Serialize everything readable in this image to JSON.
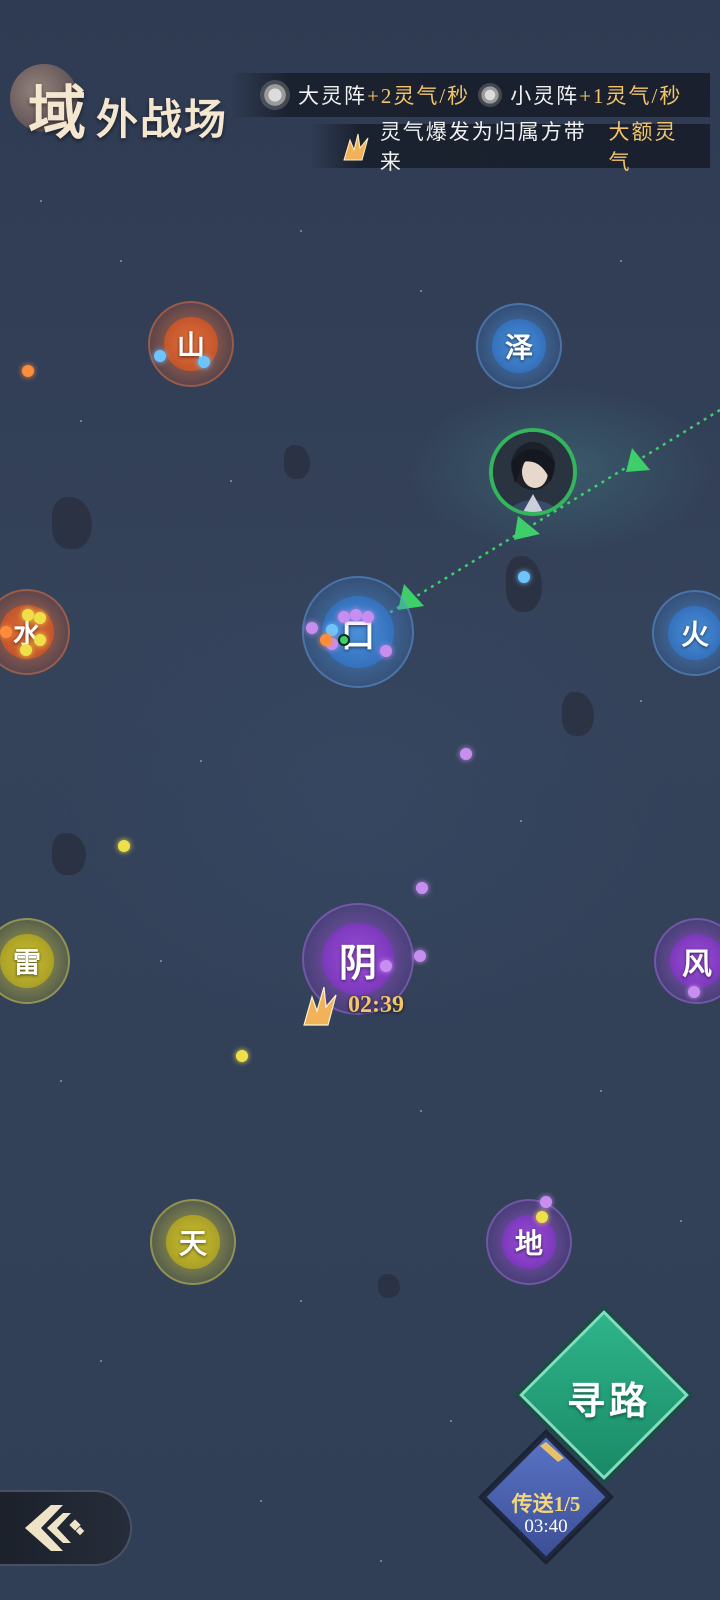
{
  "header": {
    "title_big": "域",
    "title_rest": "外战场",
    "big_array_label": "大灵阵",
    "big_array_rate": "+2灵气/秒",
    "small_array_label": "小灵阵",
    "small_array_rate": "+1灵气/秒",
    "burst_text_1": "灵气爆发为归属方带来",
    "burst_text_2": "大额灵气"
  },
  "nodes": {
    "shan": "山",
    "ze": "泽",
    "shui": "水",
    "kou": "口",
    "huo": "火",
    "lei": "雷",
    "yin": "阴",
    "feng": "风",
    "tian": "天",
    "di": "地"
  },
  "burst_timer": "02:39",
  "controls": {
    "pathfind_label": "寻路",
    "teleport_label": "传送1/5",
    "teleport_timer": "03:40"
  },
  "colors": {
    "faction_orange": "#e0703a",
    "faction_blue": "#4a8fd8",
    "faction_purple": "#9b4fd8",
    "faction_yellow": "#c9be33",
    "pathfind_green": "#2fb48a",
    "route_green": "#3ecf6a",
    "highlight_gold": "#f3c46a"
  },
  "icons": {
    "big_array": "big-array-icon",
    "small_array": "small-array-icon",
    "burst": "burst-icon",
    "back": "back-arrow-icon"
  }
}
